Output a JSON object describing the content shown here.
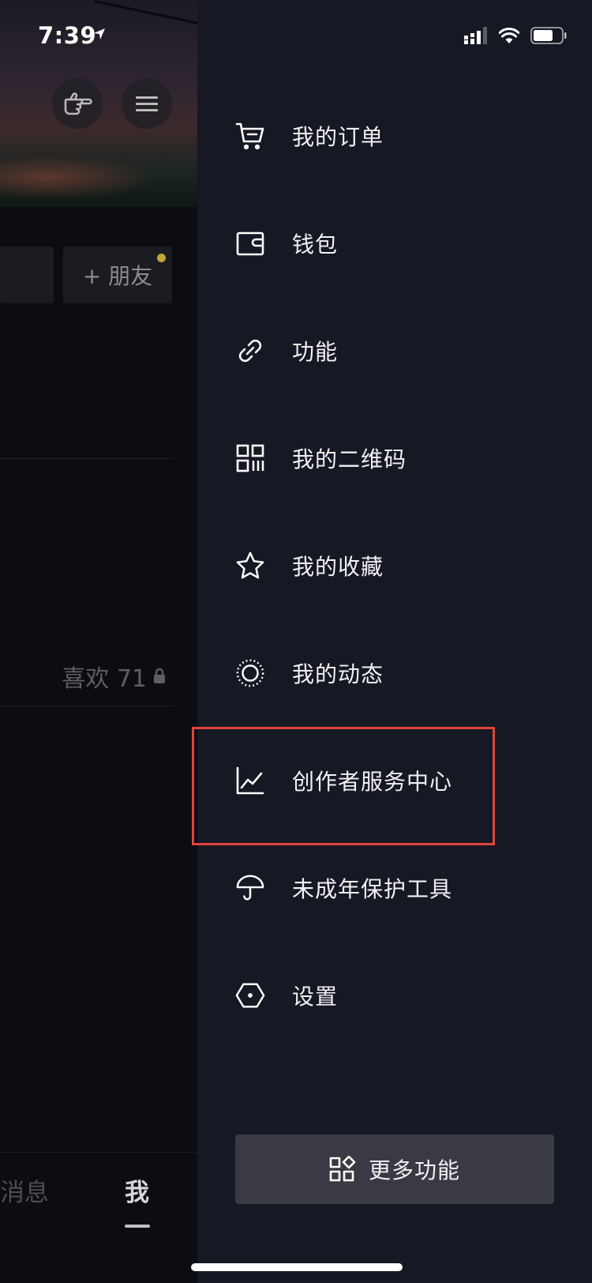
{
  "status_bar": {
    "time": "7:39"
  },
  "background": {
    "add_friend_label": "+ 朋友",
    "likes_label": "喜欢 71",
    "tabs": {
      "messages": "消息",
      "me": "我"
    }
  },
  "drawer": {
    "items": [
      {
        "label": "我的订单",
        "icon": "cart-icon"
      },
      {
        "label": "钱包",
        "icon": "wallet-icon"
      },
      {
        "label": "功能",
        "icon": "link-icon"
      },
      {
        "label": "我的二维码",
        "icon": "qr-code-icon"
      },
      {
        "label": "我的收藏",
        "icon": "star-icon"
      },
      {
        "label": "我的动态",
        "icon": "dotted-circle-icon"
      },
      {
        "label": "创作者服务中心",
        "icon": "chart-icon"
      },
      {
        "label": "未成年保护工具",
        "icon": "umbrella-icon"
      },
      {
        "label": "设置",
        "icon": "hexagon-settings-icon"
      }
    ],
    "highlighted_item": "创作者服务中心",
    "more_button_label": "更多功能"
  },
  "colors": {
    "drawer_bg": "#161823",
    "highlight_border": "#e0443a",
    "more_button_bg": "#393a43"
  }
}
